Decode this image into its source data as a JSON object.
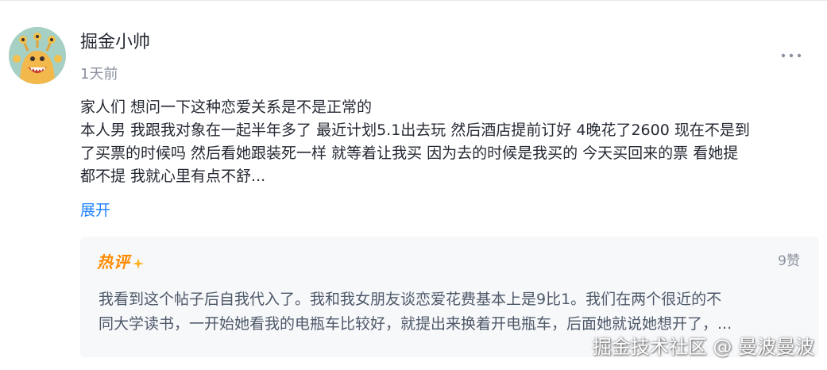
{
  "post": {
    "author_name": "掘金小帅",
    "time": "1天前",
    "more_icon": "more-horizontal-icon",
    "content_lines": [
      "家人们 想问一下这种恋爱关系是不是正常的",
      "本人男 我跟我对象在一起半年多了 最近计划5.1出去玩 然后酒店提前订好 4晚花了2600 现在不是到",
      "了买票的时候吗 然后看她跟装死一样 就等着让我买 因为去的时候是我买的 今天买回来的票 看她提",
      "都不提 我就心里有点不舒..."
    ],
    "expand_label": "展开"
  },
  "hot_comment": {
    "badge_label": "热评",
    "likes": "9赞",
    "text_lines": [
      "我看到这个帖子后自我代入了。我和我女朋友谈恋爱花费基本上是9比1。我们在两个很近的不",
      "同大学读书，一开始她看我的电瓶车比较好，就提出来换着开电瓶车，后面她就说她想开了，..."
    ]
  },
  "watermark": "掘金技术社区 @ 曼波曼波",
  "colors": {
    "link": "#1e80ff",
    "hot_badge": "#ff8a00",
    "muted_text": "#8a919f",
    "card_bg": "#f7f8fa"
  }
}
